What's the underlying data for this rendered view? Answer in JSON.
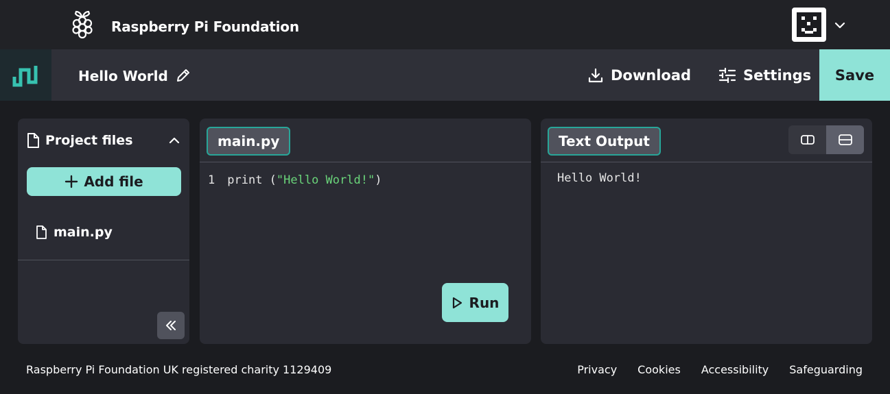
{
  "header": {
    "brand": "Raspberry Pi Foundation"
  },
  "project_bar": {
    "project_name": "Hello World",
    "download_label": "Download",
    "settings_label": "Settings",
    "save_label": "Save"
  },
  "files_panel": {
    "title": "Project files",
    "add_file_label": "Add file",
    "files": [
      {
        "name": "main.py"
      }
    ]
  },
  "code_panel": {
    "tab_label": "main.py",
    "line_number": "1",
    "code_prefix": "print (",
    "code_string": "\"Hello World!\"",
    "code_suffix": ")",
    "run_label": "Run"
  },
  "output_panel": {
    "tab_label": "Text Output",
    "output": "Hello World!"
  },
  "footer": {
    "charity_text": "Raspberry Pi Foundation UK registered charity 1129409",
    "links": [
      "Privacy",
      "Cookies",
      "Accessibility",
      "Safeguarding"
    ]
  },
  "colors": {
    "accent": "#8fe3d7",
    "tab_border": "#28a699",
    "string": "#6ad47a",
    "background": "#1b1c20",
    "panel": "#2a2b33"
  },
  "icons": {
    "brand_logo": "raspberry-icon",
    "editor_logo": "editor-logo-icon",
    "edit": "pencil-icon",
    "download": "download-icon",
    "settings": "sliders-icon",
    "file": "file-icon",
    "add": "plus-icon",
    "run": "play-icon",
    "collapse": "double-chevron-left-icon"
  }
}
